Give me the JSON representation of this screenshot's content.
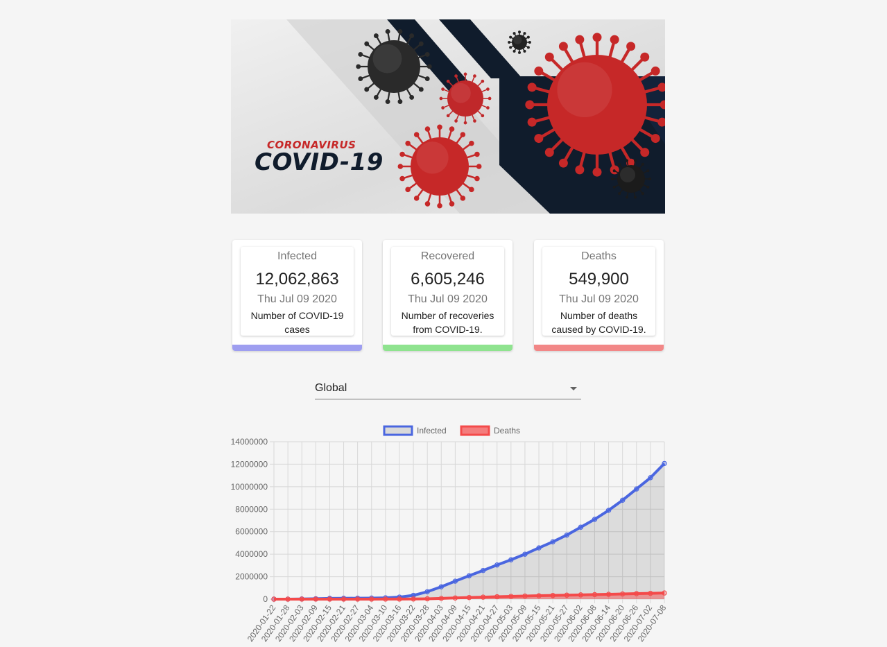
{
  "hero": {
    "subtitle": "CORONAVIRUS",
    "title": "COVID-19"
  },
  "cards": [
    {
      "label": "Infected",
      "value": "12,062,863",
      "date": "Thu Jul 09 2020",
      "description": "Number of COVID-19 cases",
      "color": "#9e9ef0"
    },
    {
      "label": "Recovered",
      "value": "6,605,246",
      "date": "Thu Jul 09 2020",
      "description": "Number of recoveries from COVID-19.",
      "color": "#8fe38f"
    },
    {
      "label": "Deaths",
      "value": "549,900",
      "date": "Thu Jul 09 2020",
      "description": "Number of deaths caused by COVID-19.",
      "color": "#f28787"
    }
  ],
  "country_select": {
    "selected": "Global"
  },
  "chart_data": {
    "type": "line",
    "legend_position": "top",
    "grid": true,
    "ylim": [
      0,
      14000000
    ],
    "y_ticks": [
      0,
      2000000,
      4000000,
      6000000,
      8000000,
      10000000,
      12000000,
      14000000
    ],
    "x_tick_labels": [
      "2020-01-22",
      "2020-01-28",
      "2020-02-03",
      "2020-02-09",
      "2020-02-15",
      "2020-02-21",
      "2020-02-27",
      "2020-03-04",
      "2020-03-10",
      "2020-03-16",
      "2020-03-22",
      "2020-03-28",
      "2020-04-03",
      "2020-04-09",
      "2020-04-15",
      "2020-04-21",
      "2020-04-27",
      "2020-05-03",
      "2020-05-09",
      "2020-05-15",
      "2020-05-21",
      "2020-05-27",
      "2020-06-02",
      "2020-06-08",
      "2020-06-14",
      "2020-06-20",
      "2020-06-26",
      "2020-07-02",
      "2020-07-08"
    ],
    "series": [
      {
        "name": "Infected",
        "color": "#4a66e0",
        "fill": "rgba(0,0,0,0.1)",
        "values": [
          555,
          2800,
          17000,
          37000,
          69000,
          77000,
          83000,
          95000,
          119000,
          182000,
          337000,
          660000,
          1100000,
          1600000,
          2080000,
          2550000,
          3040000,
          3500000,
          4000000,
          4560000,
          5100000,
          5700000,
          6400000,
          7100000,
          7900000,
          8800000,
          9800000,
          10800000,
          12062863
        ]
      },
      {
        "name": "Deaths",
        "color": "#f44a4a",
        "fill": "rgba(244,74,74,0.5)",
        "values": [
          17,
          133,
          425,
          900,
          1600,
          2300,
          2800,
          3300,
          4300,
          7200,
          14700,
          33000,
          66000,
          106000,
          145000,
          180000,
          215000,
          244000,
          275000,
          305000,
          330000,
          355000,
          380000,
          405000,
          430000,
          460000,
          495000,
          520000,
          549900
        ]
      }
    ]
  }
}
